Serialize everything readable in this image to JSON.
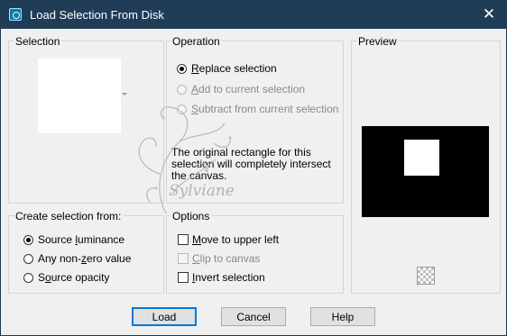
{
  "window": {
    "title": "Load Selection From Disk",
    "close_glyph": "✕"
  },
  "selection": {
    "label": "Selection"
  },
  "operation": {
    "label": "Operation",
    "options": [
      {
        "pre": "",
        "u": "R",
        "post": "eplace selection",
        "selected": true,
        "enabled": true
      },
      {
        "pre": "",
        "u": "A",
        "post": "dd to current selection",
        "selected": false,
        "enabled": false
      },
      {
        "pre": "",
        "u": "S",
        "post": "ubtract from current selection",
        "selected": false,
        "enabled": false
      }
    ],
    "note_line1": "The original rectangle for this",
    "note_line2": "selection will completely intersect",
    "note_line3": "the canvas."
  },
  "preview": {
    "label": "Preview"
  },
  "create_from": {
    "label": "Create selection from:",
    "options": [
      {
        "pre": "Source ",
        "u": "l",
        "post": "uminance",
        "selected": true
      },
      {
        "pre": "Any non-",
        "u": "z",
        "post": "ero value",
        "selected": false
      },
      {
        "pre": "S",
        "u": "o",
        "post": "urce opacity",
        "selected": false
      }
    ]
  },
  "options": {
    "label": "Options",
    "items": [
      {
        "pre": "",
        "u": "M",
        "post": "ove to upper left",
        "checked": false,
        "enabled": true
      },
      {
        "pre": "",
        "u": "C",
        "post": "lip to canvas",
        "checked": false,
        "enabled": false
      },
      {
        "pre": "",
        "u": "I",
        "post": "nvert selection",
        "checked": false,
        "enabled": true
      }
    ]
  },
  "buttons": {
    "load": "Load",
    "cancel": "Cancel",
    "help": "Help"
  },
  "watermark_text": "Sylviane"
}
